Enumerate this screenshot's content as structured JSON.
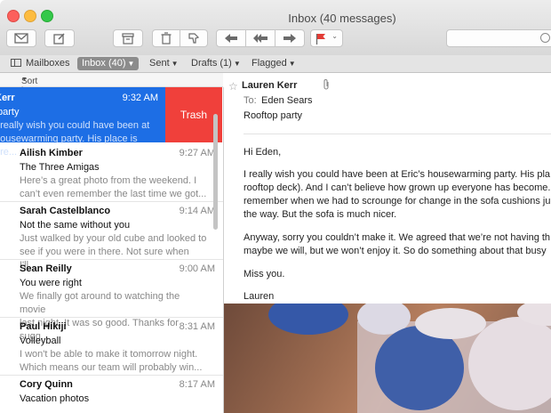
{
  "window": {
    "title": "Inbox (40 messages)"
  },
  "favorites": {
    "mailboxes": "Mailboxes",
    "inbox": "Inbox (40)",
    "sent": "Sent",
    "drafts": "Drafts (1)",
    "flagged": "Flagged"
  },
  "list": {
    "sort_label": "Sort by Date",
    "trash_label": "Trash",
    "messages": [
      {
        "sender": "Kerr",
        "time": "9:32 AM",
        "subject": "party",
        "preview": "I really wish you could have been at\nhousewarming party. His place is pre..."
      },
      {
        "sender": "Ailish Kimber",
        "time": "9:27 AM",
        "subject": "The Three Amigas",
        "preview": "Here’s a great photo from the weekend. I\ncan’t even remember the last time we got..."
      },
      {
        "sender": "Sarah Castelblanco",
        "time": "9:14 AM",
        "subject": "Not the same without you",
        "preview": "Just walked by your old cube and looked to\nsee if you were in there. Not sure when I'll..."
      },
      {
        "sender": "Sean Reilly",
        "time": "9:00 AM",
        "subject": "You were right",
        "preview": "We finally got around to watching the movie\nlast night. It was so good. Thanks for sugg..."
      },
      {
        "sender": "Paul Hikiji",
        "time": "8:31 AM",
        "subject": "Volleyball",
        "preview": "I won't be able to make it tomorrow night.\nWhich means our team will probably win..."
      },
      {
        "sender": "Cory Quinn",
        "time": "8:17 AM",
        "subject": "Vacation photos",
        "preview": ""
      }
    ]
  },
  "message": {
    "from": "Lauren Kerr",
    "to_label": "To:",
    "to": "Eden Sears",
    "subject": "Rooftop party",
    "greeting": "Hi Eden,",
    "p1_l1": "I really wish you could have been at Eric’s housewarming party. His pla",
    "p1_l2": "rooftop deck). And I can’t believe how grown up everyone has become.",
    "p1_l3": "remember when we had to scrounge for change in the sofa cushions ju",
    "p1_l4": "the way. But the sofa is much nicer.",
    "p2_l1": "Anyway, sorry you couldn’t make it. We agreed that we’re not having th",
    "p2_l2": "maybe we will, but we won’t enjoy it. So do something about that busy",
    "closing": "Miss you.",
    "signature": "Lauren"
  },
  "colors": {
    "selection": "#1d6ee5",
    "trash": "#f0403b",
    "flag": "#e23b35"
  },
  "icons": [
    "envelope-icon",
    "compose-icon",
    "archive-icon",
    "trash-icon",
    "junk-icon",
    "reply-icon",
    "reply-all-icon",
    "forward-icon",
    "flag-icon",
    "mailboxes-icon",
    "paperclip-icon",
    "star-icon",
    "search-icon"
  ]
}
